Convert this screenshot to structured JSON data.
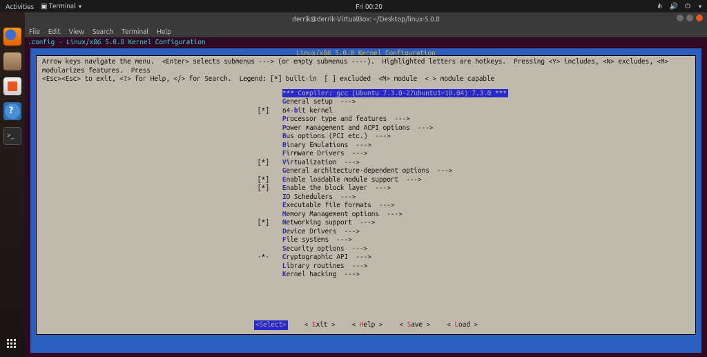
{
  "topbar": {
    "activities": "Activities",
    "app": "Terminal",
    "clock": "Fri 00:20"
  },
  "window": {
    "title": "derrik@derrik-VirtualBox: ~/Desktop/linux-5.0.8"
  },
  "menubar": [
    "File",
    "Edit",
    "View",
    "Search",
    "Terminal",
    "Help"
  ],
  "term_header": ".config - Linux/x86 5.0.8 Kernel Configuration",
  "mc": {
    "title": "Linux/x86 5.0.8 Kernel Configuration",
    "help1": "Arrow keys navigate the menu.  <Enter> selects submenus ---> (or empty submenus ----).  Highlighted letters are hotkeys.  Pressing <Y> includes, <N> excludes, <M> modularizes features.  Press",
    "help2": "<Esc><Esc> to exit, <?> for Help, </> for Search.  Legend: [*] built-in  [ ] excluded  <M> module  < > module capable",
    "items": [
      {
        "mark": "   ",
        "hot": "",
        "pre": "*** ",
        "text": "Compiler: gcc (Ubuntu 7.3.0-27ubuntu1~18.04) 7.3.0 ***",
        "selected": true
      },
      {
        "mark": "   ",
        "hot": "G",
        "text": "eneral setup  --->"
      },
      {
        "mark": "[*]",
        "hot": "",
        "text": "64-",
        "hot2": "b",
        "text2": "it kernel"
      },
      {
        "mark": "   ",
        "hot": "P",
        "text": "rocessor type and features  --->"
      },
      {
        "mark": "   ",
        "hot": "P",
        "text": "ower management and ACPI options  --->"
      },
      {
        "mark": "   ",
        "hot": "B",
        "text": "us options (PCI etc.)  --->"
      },
      {
        "mark": "   ",
        "hot": "B",
        "text": "inary Emulations  --->"
      },
      {
        "mark": "   ",
        "hot": "F",
        "text": "irmware Drivers  --->"
      },
      {
        "mark": "[*]",
        "hot": "V",
        "text": "irtualization  --->"
      },
      {
        "mark": "   ",
        "hot": "G",
        "text": "eneral architecture-dependent options  --->"
      },
      {
        "mark": "[*]",
        "hot": "E",
        "text": "nable loadable module support  --->"
      },
      {
        "mark": "[*]",
        "hot": "E",
        "text": "nable the block layer  --->"
      },
      {
        "mark": "   ",
        "hot": "I",
        "text": "O Schedulers  --->"
      },
      {
        "mark": "   ",
        "hot": "E",
        "text": "xecutable file formats  --->"
      },
      {
        "mark": "   ",
        "hot": "M",
        "text": "emory Management options  --->"
      },
      {
        "mark": "[*]",
        "hot": "N",
        "text": "etworking support  --->"
      },
      {
        "mark": "   ",
        "hot": "D",
        "text": "evice Drivers  --->"
      },
      {
        "mark": "   ",
        "hot": "F",
        "text": "ile systems  --->"
      },
      {
        "mark": "   ",
        "hot": "S",
        "text": "ecurity options  --->"
      },
      {
        "mark": "-*-",
        "hot": "C",
        "text": "ryptographic API  --->"
      },
      {
        "mark": "   ",
        "hot": "L",
        "text": "ibrary routines  --->"
      },
      {
        "mark": "   ",
        "hot": "K",
        "text": "ernel hacking  --->"
      }
    ],
    "buttons": [
      {
        "pre": "<",
        "hot": "S",
        "post": "elect>",
        "sel": true
      },
      {
        "pre": "< ",
        "hot": "E",
        "post": "xit >"
      },
      {
        "pre": "< ",
        "hot": "H",
        "post": "elp >"
      },
      {
        "pre": "< ",
        "hot": "S",
        "post": "ave >"
      },
      {
        "pre": "< ",
        "hot": "L",
        "post": "oad >"
      }
    ]
  }
}
